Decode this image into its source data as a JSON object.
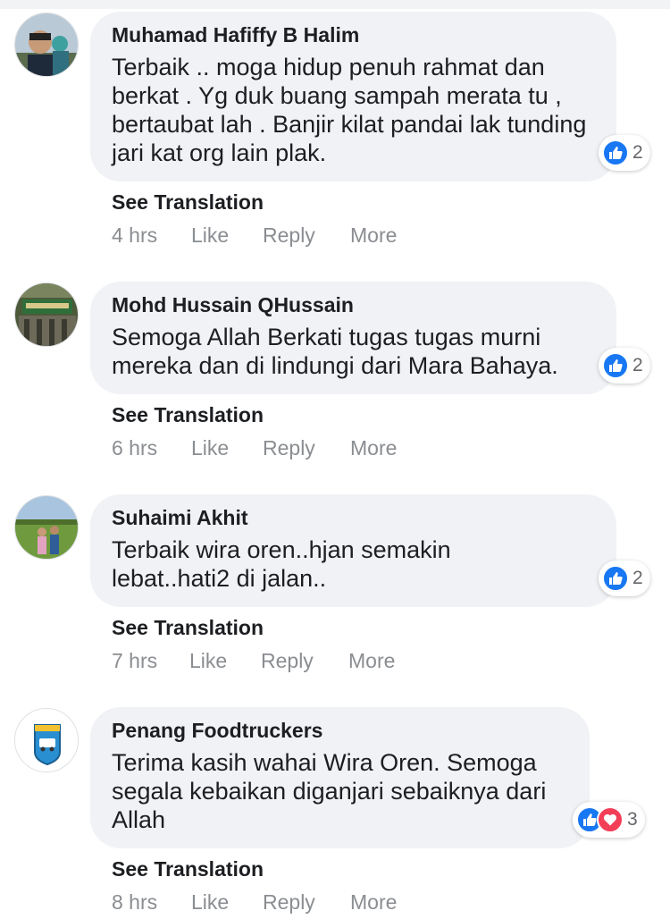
{
  "comments": [
    {
      "author": "Muhamad Hafiffy B Halim",
      "text": "Terbaik .. moga hidup penuh rahmat dan berkat . Yg duk buang sampah merata tu , bertaubat lah . Banjir kilat pandai lak tunding jari kat org lain plak.",
      "reaction_count": "2",
      "reactions": [
        "like"
      ],
      "see_translation": "See Translation",
      "time": "4 hrs",
      "like": "Like",
      "reply": "Reply",
      "more": "More"
    },
    {
      "author": "Mohd Hussain QHussain",
      "text": "Semoga Allah Berkati tugas tugas murni mereka dan di lindungi dari Mara Bahaya.",
      "reaction_count": "2",
      "reactions": [
        "like"
      ],
      "see_translation": "See Translation",
      "time": "6 hrs",
      "like": "Like",
      "reply": "Reply",
      "more": "More"
    },
    {
      "author": "Suhaimi Akhit",
      "text": "Terbaik wira oren..hjan semakin lebat..hati2 di jalan..",
      "reaction_count": "2",
      "reactions": [
        "like"
      ],
      "see_translation": "See Translation",
      "time": "7 hrs",
      "like": "Like",
      "reply": "Reply",
      "more": "More"
    },
    {
      "author": "Penang Foodtruckers",
      "text": "Terima kasih wahai Wira Oren. Semoga segala kebaikan diganjari sebaiknya dari Allah",
      "reaction_count": "3",
      "reactions": [
        "like",
        "love"
      ],
      "see_translation": "See Translation",
      "time": "8 hrs",
      "like": "Like",
      "reply": "Reply",
      "more": "More"
    }
  ],
  "colors": {
    "bubble": "#f0f2f5",
    "like": "#1877f2",
    "love": "#f33e58",
    "meta": "#8a8d91"
  }
}
